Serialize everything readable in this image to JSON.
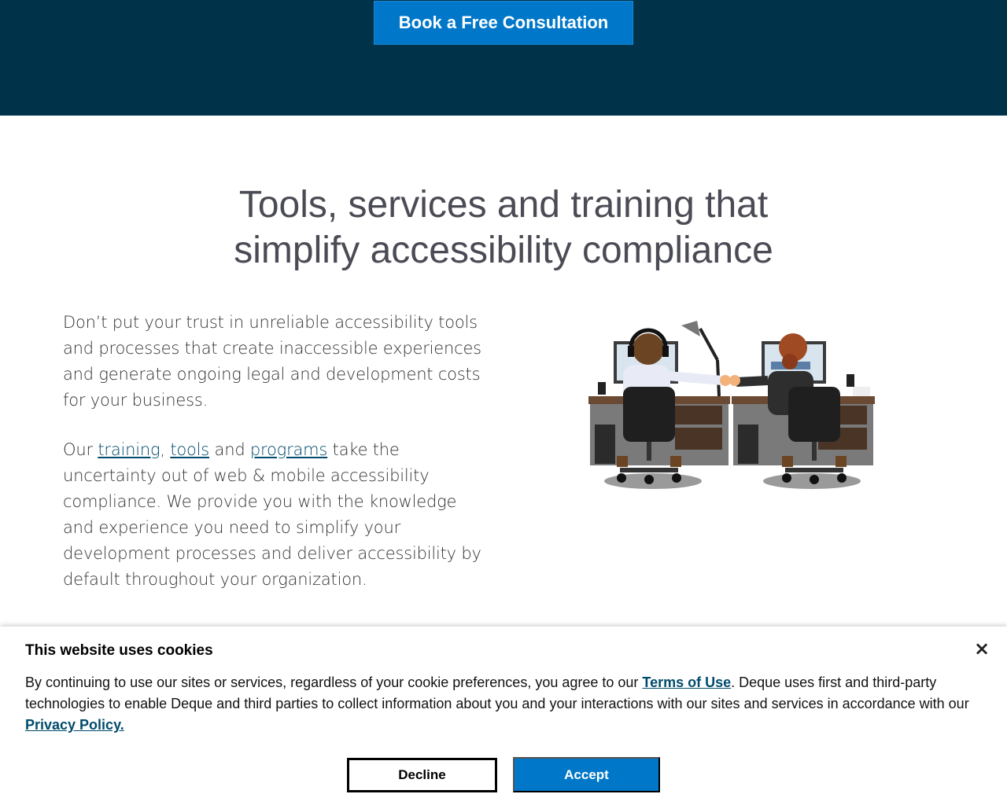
{
  "hero": {
    "cta_label": "Book a Free Consultation",
    "background": "#003349",
    "cta_color": "#0077c8"
  },
  "main": {
    "headline_line1": "Tools, services and training that",
    "headline_line2": "simplify accessibility compliance",
    "paragraph1": "Don’t put your trust in unreliable accessibility tools and processes that create inaccessible experiences and generate ongoing legal and development costs for your business.",
    "paragraph2": {
      "prefix": "Our ",
      "link_training": "training",
      "sep1": ", ",
      "link_tools": "tools",
      "sep2": " and ",
      "link_programs": "programs",
      "suffix": " take the uncertainty out of web & mobile accessibility compliance. We provide you with the knowledge and experience you need to simplify your development processes and deliver accessibility by default throughout your organization."
    },
    "illustration_icon": "two-coworkers-fist-bump-illustration"
  },
  "cookie_banner": {
    "title": "This website uses cookies",
    "close_icon": "close-icon",
    "text_before_terms": "By continuing to use our sites or services, regardless of your cookie preferences, you agree to our ",
    "terms_link": "Terms of Use",
    "text_middle": ". Deque uses first and third-party technologies to enable Deque and third parties to collect information about you and your interactions with our sites and services in accordance with our ",
    "privacy_link": "Privacy Policy.",
    "decline_label": "Decline",
    "accept_label": "Accept"
  }
}
